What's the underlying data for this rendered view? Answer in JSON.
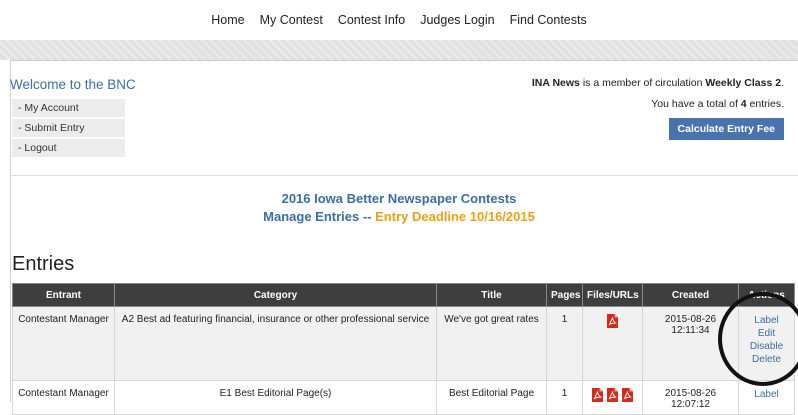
{
  "nav": [
    "Home",
    "My Contest",
    "Contest Info",
    "Judges Login",
    "Find Contests"
  ],
  "welcome": "Welcome to the BNC",
  "account_menu": [
    "- My Account",
    "- Submit Entry",
    "- Logout"
  ],
  "info": {
    "paper": "INA News",
    "member_text": " is a member of circulation ",
    "circulation": "Weekly Class 2",
    "period": ".",
    "total_pre": "You have a total of ",
    "total_count": "4",
    "total_post": " entries."
  },
  "calc_button": "Calculate Entry Fee",
  "contest": {
    "title": "2016 Iowa Better Newspaper Contests",
    "manage": "Manage Entries -- ",
    "deadline": "Entry Deadline 10/16/2015"
  },
  "entries_heading": "Entries",
  "table": {
    "headers": [
      "Entrant",
      "Category",
      "Title",
      "Pages",
      "Files/URLs",
      "Created",
      "Actions"
    ],
    "rows": [
      {
        "entrant": "Contestant Manager",
        "category": "A2 Best ad featuring financial, insurance or other professional service",
        "title": "We've got great rates",
        "pages": "1",
        "files": 1,
        "created": "2015-08-26 12:11:34",
        "actions": [
          "Label",
          "Edit",
          "Disable",
          "Delete"
        ]
      },
      {
        "entrant": "Contestant Manager",
        "category": "E1 Best Editorial Page(s)",
        "title": "Best Editorial Page",
        "pages": "1",
        "files": 3,
        "created": "2015-08-26 12:07:12",
        "actions": [
          "Label"
        ]
      }
    ]
  },
  "colors": {
    "link_blue": "#3b6ea5",
    "deadline_orange": "#e8a21a",
    "header_dark": "#3e3e3e",
    "button_blue": "#4a73ad",
    "pdf_red": "#d9291c"
  },
  "icons": {
    "file": "pdf-file-icon"
  }
}
